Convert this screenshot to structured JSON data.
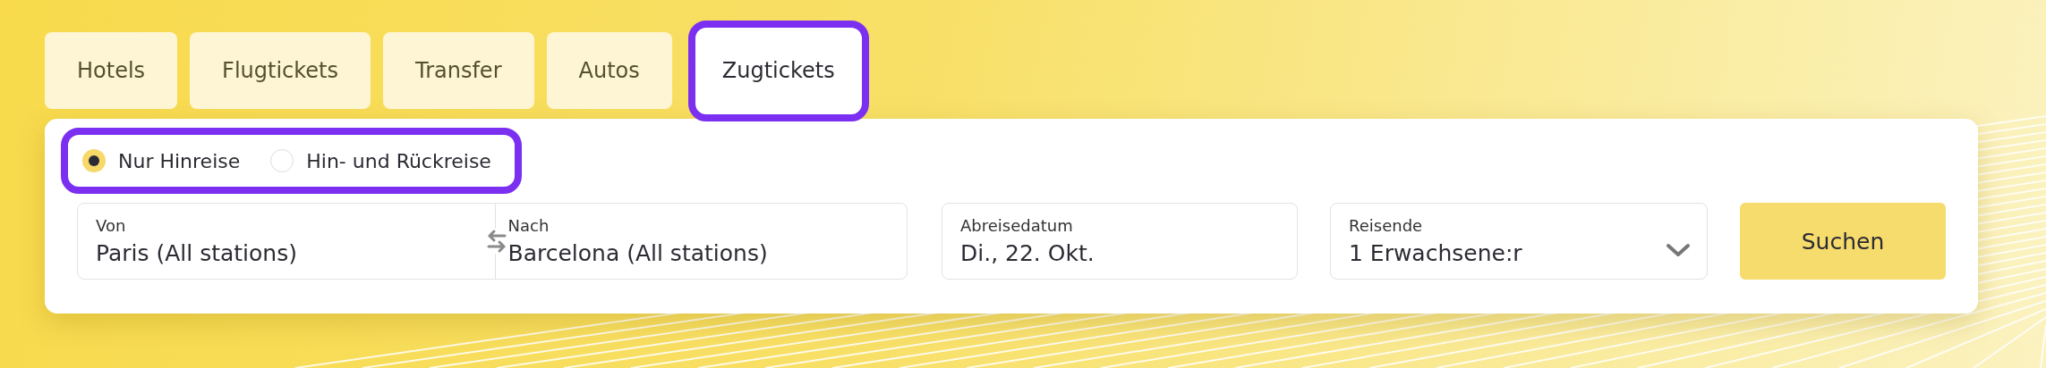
{
  "tabs": [
    {
      "label": "Hotels",
      "selected": false
    },
    {
      "label": "Flugtickets",
      "selected": false
    },
    {
      "label": "Transfer",
      "selected": false
    },
    {
      "label": "Autos",
      "selected": false
    },
    {
      "label": "Zugtickets",
      "selected": true
    }
  ],
  "trip_type": {
    "highlighted": true,
    "options": [
      {
        "label": "Nur Hinreise",
        "selected": true
      },
      {
        "label": "Hin- und Rückreise",
        "selected": false
      }
    ]
  },
  "route": {
    "from": {
      "label": "Von",
      "value": "Paris (All stations)"
    },
    "to": {
      "label": "Nach",
      "value": "Barcelona (All stations)"
    }
  },
  "date": {
    "label": "Abreisedatum",
    "value": "Di., 22. Okt."
  },
  "travelers": {
    "label": "Reisende",
    "value": "1 Erwachsene:r"
  },
  "search_button": "Suchen"
}
